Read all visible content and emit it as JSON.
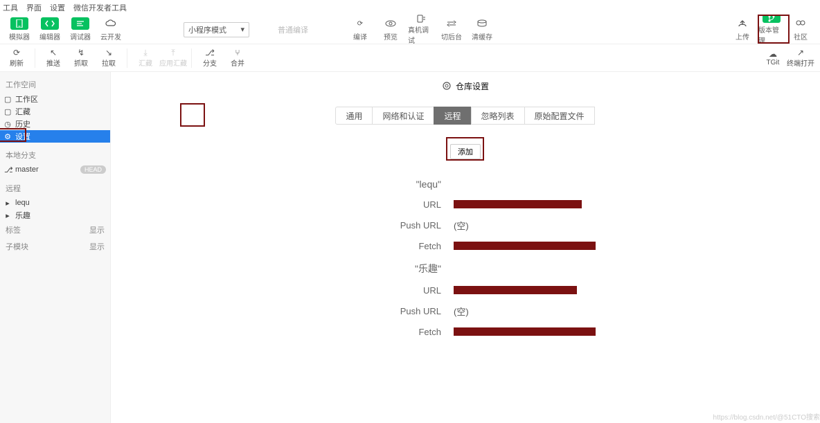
{
  "menubar": [
    "工具",
    "界面",
    "设置",
    "微信开发者工具"
  ],
  "toolbar": {
    "simulator": "模拟器",
    "editor": "编辑器",
    "debugger": "调试器",
    "cloud": "云开发",
    "mode": "小程序模式",
    "compile_label": "普通编译",
    "mid": {
      "compile": "编译",
      "preview": "预览",
      "real": "真机调试",
      "switchbg": "切后台",
      "clear": "清缓存"
    },
    "right": {
      "upload": "上传",
      "version": "版本管理",
      "community": "社区"
    }
  },
  "subtoolbar": {
    "refresh": "刷新",
    "push": "推送",
    "fetch": "抓取",
    "pull": "拉取",
    "hidden1": "汇藏",
    "hidden2": "应用汇藏",
    "branch": "分支",
    "merge": "合并",
    "tgit": "TGit",
    "openterm": "终端打开"
  },
  "sidebar": {
    "workspace_section": "工作空间",
    "workspace": "工作区",
    "stash": "汇藏",
    "history": "历史",
    "settings": "设置",
    "localbranch_section": "本地分支",
    "master": "master",
    "head": "HEAD",
    "remote_section": "远程",
    "remote1": "lequ",
    "remote2": "乐趣",
    "tags_section": "标签",
    "tags_show": "显示",
    "submod_section": "子模块",
    "submod_show": "显示"
  },
  "page": {
    "title": "仓库设置",
    "tabs": {
      "general": "通用",
      "net": "网络和认证",
      "remote": "远程",
      "ignore": "忽略列表",
      "raw": "原始配置文件"
    },
    "add": "添加",
    "remotes": [
      {
        "name": "\"lequ\"",
        "url_label": "URL",
        "url_censor_w": 185,
        "push_label": "Push URL",
        "push_val": "(空)",
        "fetch_label": "Fetch",
        "fetch_censor_w": 205
      },
      {
        "name": "\"乐趣\"",
        "url_label": "URL",
        "url_censor_w": 178,
        "push_label": "Push URL",
        "push_val": "(空)",
        "fetch_label": "Fetch",
        "fetch_censor_w": 205
      }
    ]
  },
  "watermark": "https://blog.csdn.net/@51CTO搜索"
}
